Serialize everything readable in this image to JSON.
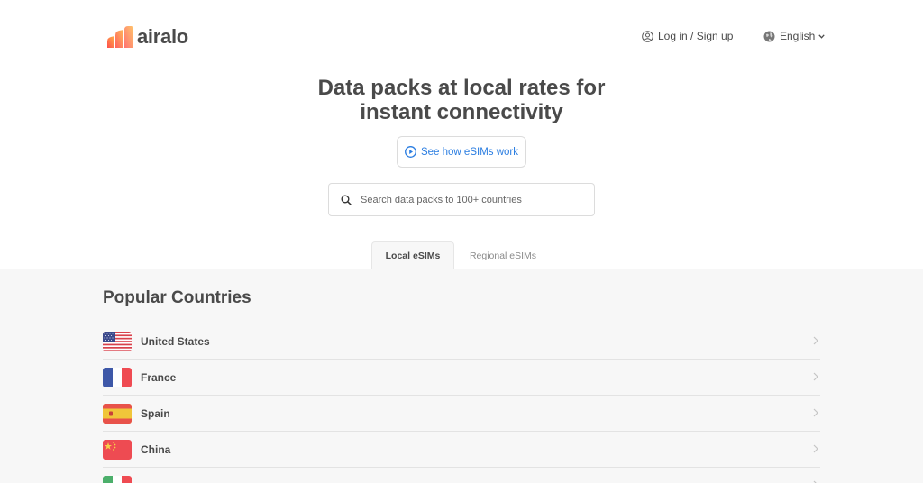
{
  "header": {
    "logo_text": "airalo",
    "login_label": "Log in / Sign up",
    "language_label": "English"
  },
  "hero": {
    "title_line1": "Data packs at local rates for",
    "title_line2": "instant connectivity",
    "how_button_label": "See how eSIMs work",
    "search_placeholder": "Search data packs to 100+ countries"
  },
  "tabs": [
    {
      "label": "Local eSIMs",
      "active": true
    },
    {
      "label": "Regional eSIMs",
      "active": false
    }
  ],
  "popular": {
    "title": "Popular Countries",
    "countries": [
      {
        "name": "United States",
        "flag": "us-flag"
      },
      {
        "name": "France",
        "flag": "france-flag"
      },
      {
        "name": "Spain",
        "flag": "spain-flag"
      },
      {
        "name": "China",
        "flag": "china-flag"
      },
      {
        "name": "",
        "flag": "italy-flag"
      }
    ]
  },
  "colors": {
    "accent_blue": "#2a7de1",
    "text": "#4a4a4a",
    "logo_gradient_start": "#ff4d4d",
    "logo_gradient_end": "#ffb347",
    "content_bg": "#f7f7f7"
  }
}
